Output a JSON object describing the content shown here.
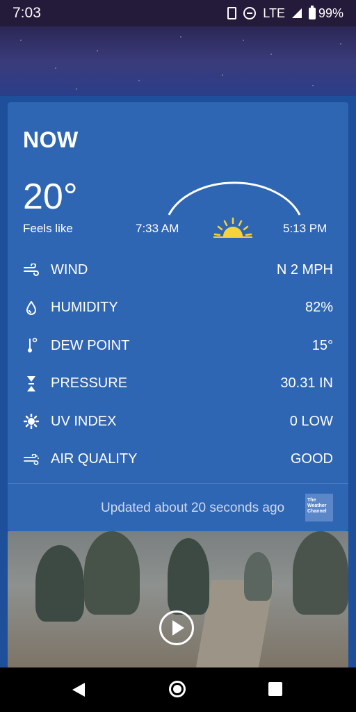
{
  "status_bar": {
    "time": "7:03",
    "network": "LTE",
    "battery": "99%"
  },
  "card": {
    "title": "NOW",
    "temperature": "20°",
    "feels_like_label": "Feels like",
    "sunrise": "7:33 AM",
    "sunset": "5:13 PM",
    "rows": [
      {
        "label": "WIND",
        "value": "N 2 MPH",
        "icon": "wind-icon"
      },
      {
        "label": "HUMIDITY",
        "value": "82%",
        "icon": "droplet-icon"
      },
      {
        "label": "DEW POINT",
        "value": "15°",
        "icon": "thermometer-icon"
      },
      {
        "label": "PRESSURE",
        "value": "30.31 IN",
        "icon": "pressure-icon"
      },
      {
        "label": "UV INDEX",
        "value": "0 LOW",
        "icon": "uv-sun-icon"
      },
      {
        "label": "AIR QUALITY",
        "value": "GOOD",
        "icon": "air-quality-icon"
      }
    ],
    "updated": "Updated about 20 seconds ago",
    "logo": "The Weather Channel"
  },
  "colors": {
    "card_bg": "#2f66b4",
    "page_bg": "#1d4f9b",
    "sun": "#f5d33b"
  }
}
